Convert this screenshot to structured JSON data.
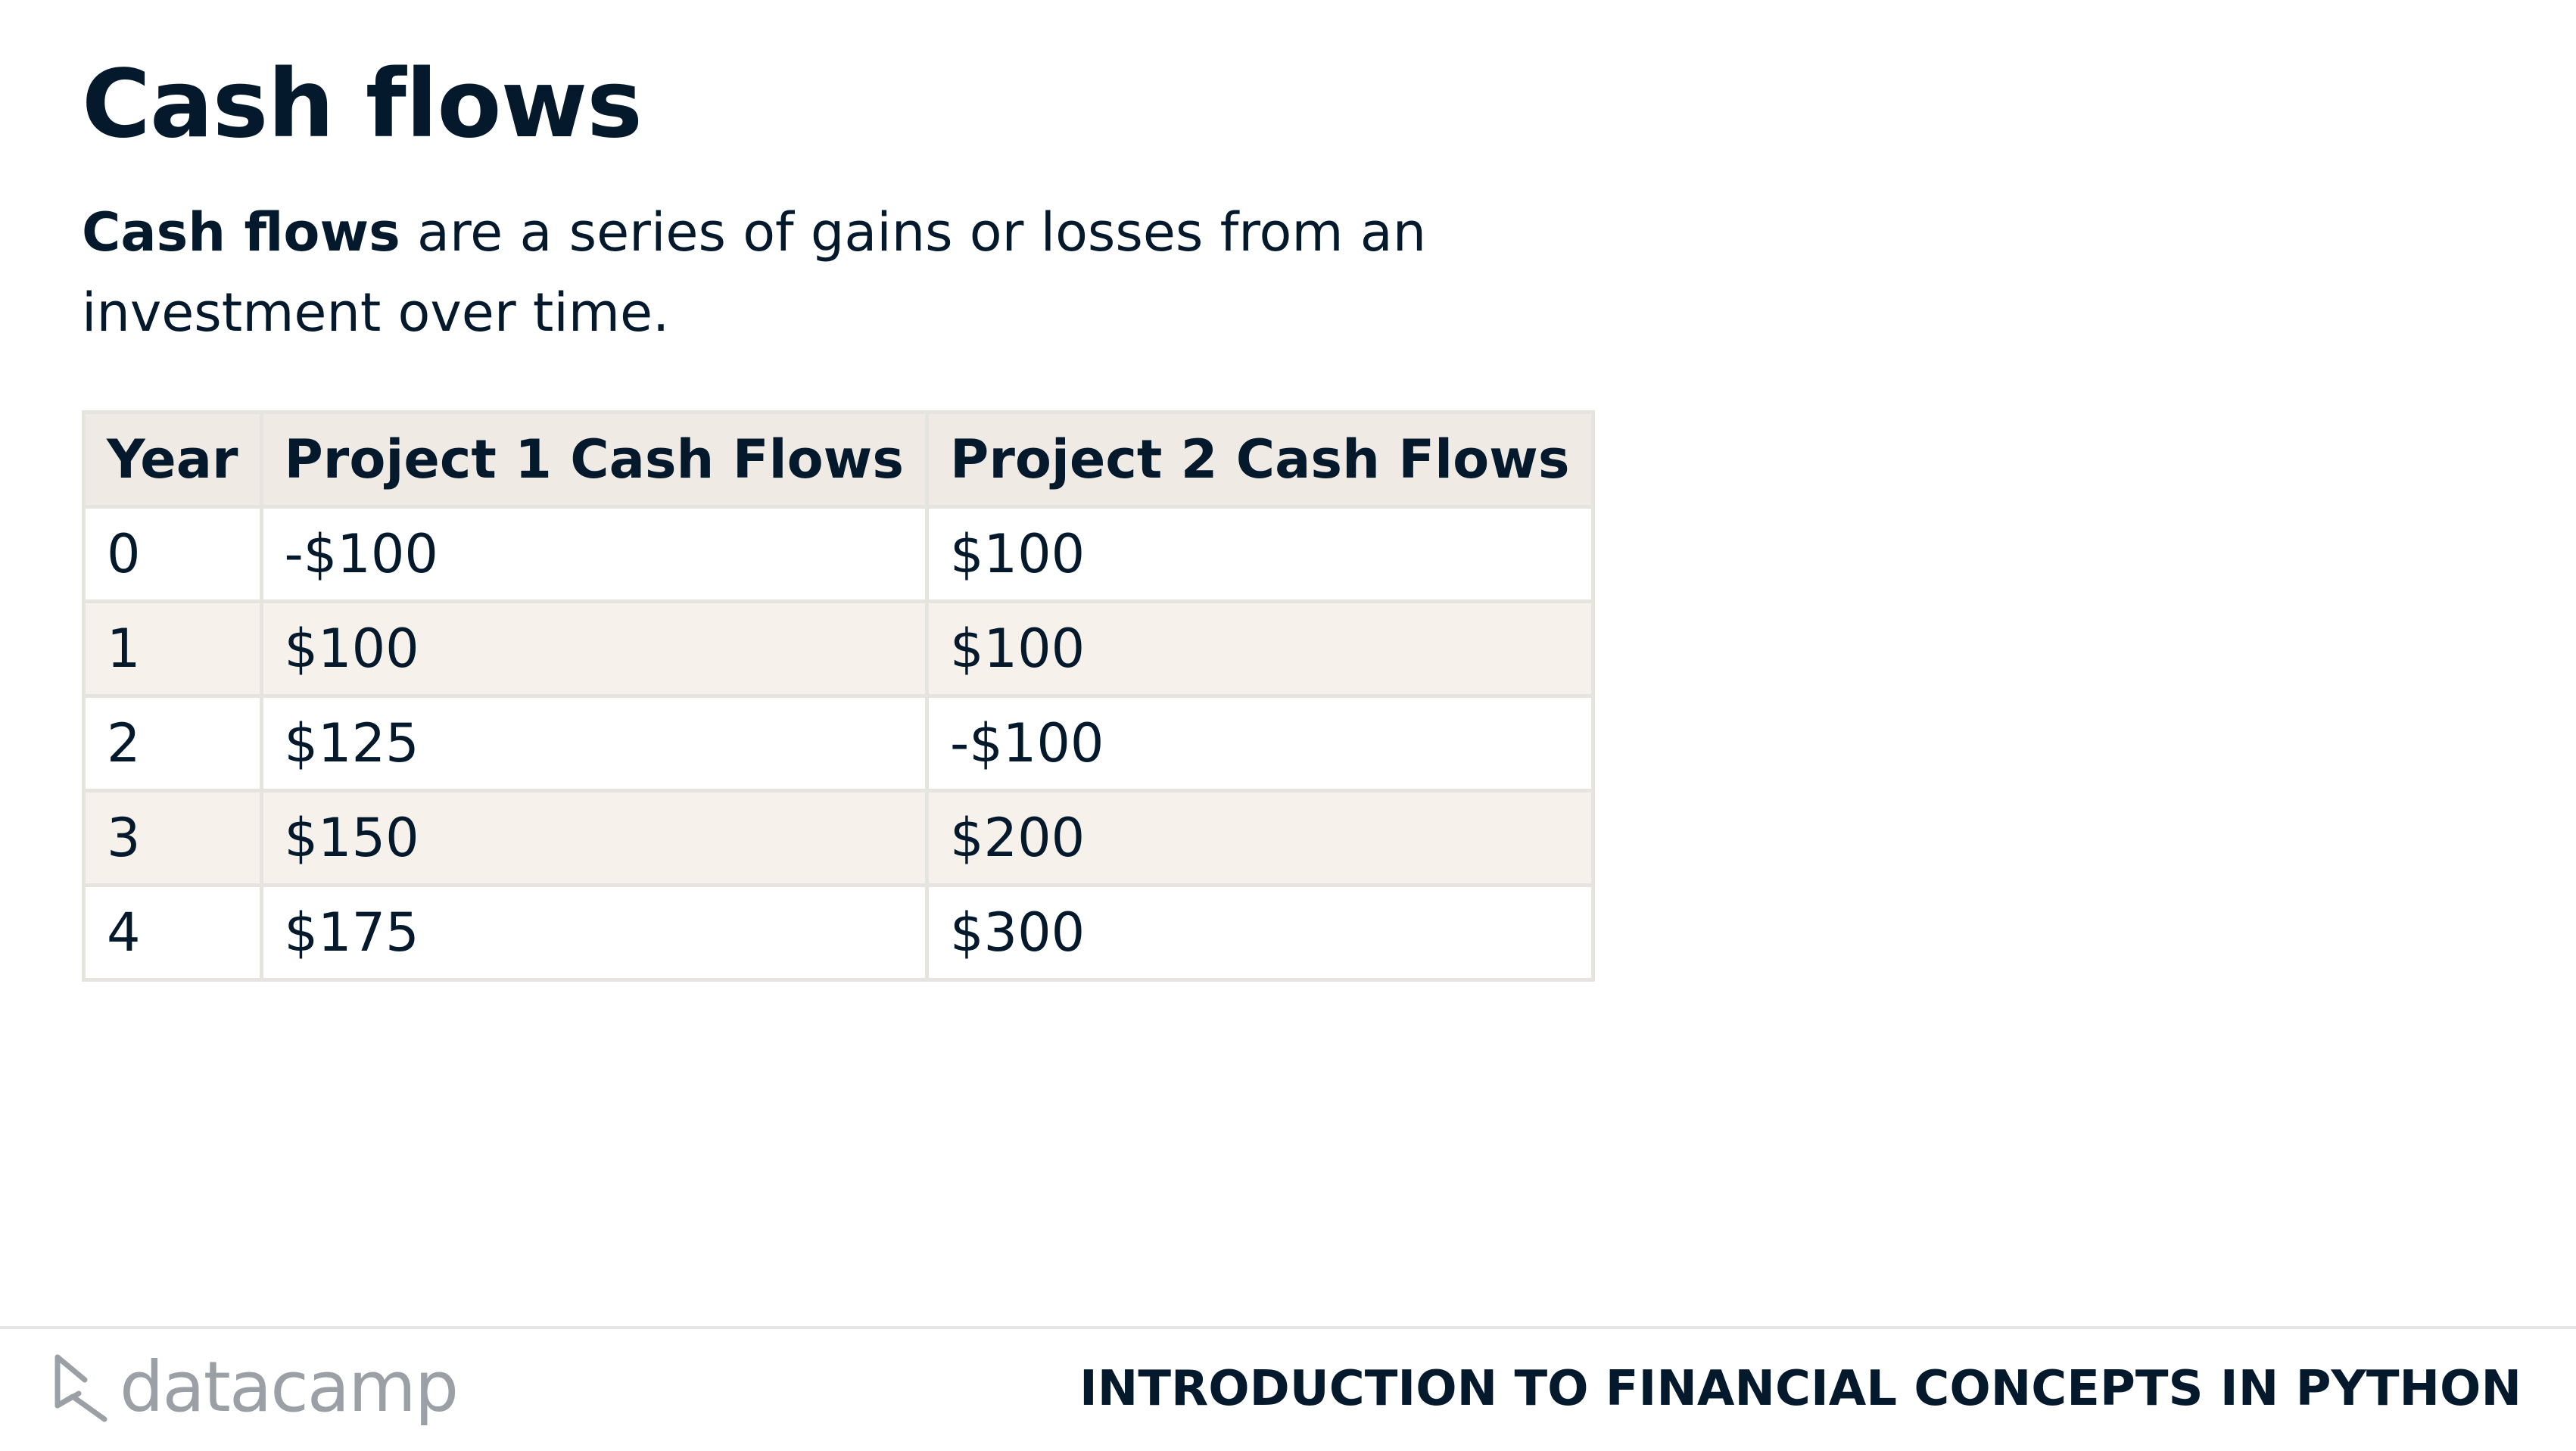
{
  "slide": {
    "title": "Cash flows",
    "intro_bold": "Cash flows",
    "intro_rest": " are a series of gains or losses from an investment over time."
  },
  "table": {
    "headers": [
      "Year",
      "Project 1 Cash Flows",
      "Project 2 Cash Flows"
    ],
    "rows": [
      [
        "0",
        "-$100",
        "$100"
      ],
      [
        "1",
        "$100",
        "$100"
      ],
      [
        "2",
        "$125",
        "-$100"
      ],
      [
        "3",
        "$150",
        "$200"
      ],
      [
        "4",
        "$175",
        "$300"
      ]
    ]
  },
  "footer": {
    "logo_text": "datacamp",
    "course_title": "INTRODUCTION TO FINANCIAL CONCEPTS IN PYTHON"
  },
  "colors": {
    "text": "#05192d",
    "header_bg": "#efebe4",
    "stripe_bg": "#f6f2eb",
    "border": "#e6e4df",
    "logo_gray": "#9aa0a6"
  },
  "icons": {
    "logo": "datacamp-logo-icon"
  }
}
